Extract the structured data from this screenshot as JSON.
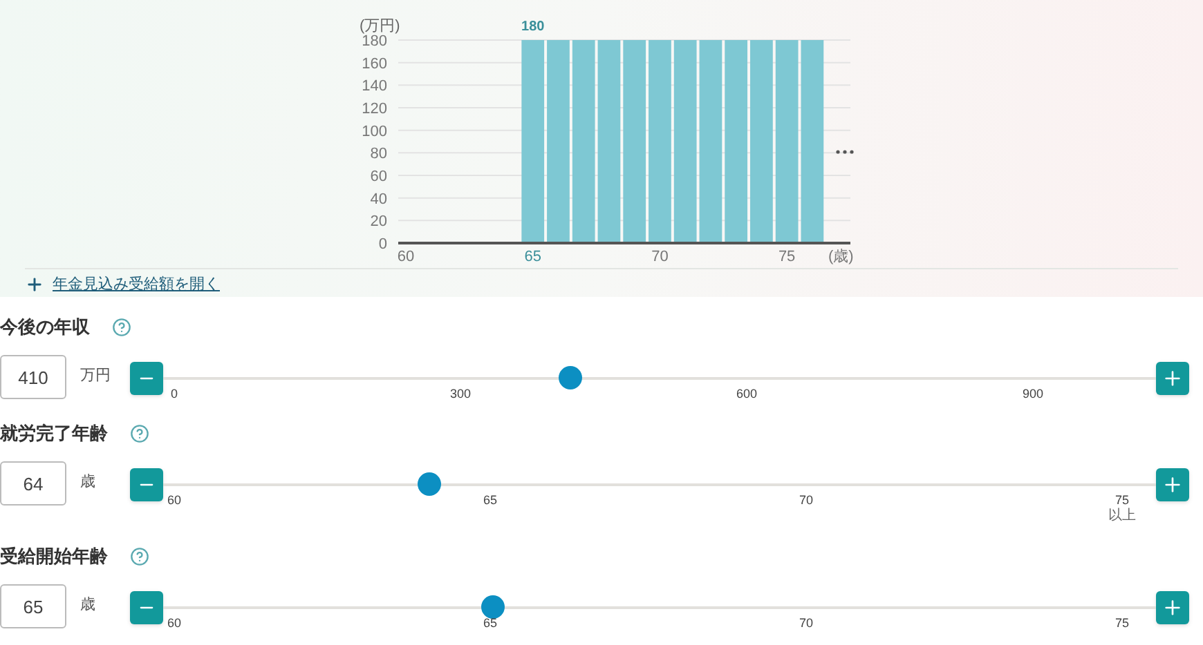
{
  "chart": {
    "chart_data": {
      "type": "bar",
      "ylabel": "(万円)",
      "xlabel": "(歳)",
      "x": [
        65,
        66,
        67,
        68,
        69,
        70,
        71,
        72,
        73,
        74,
        75,
        76
      ],
      "series": [
        {
          "color": "#7ec8d3",
          "values": [
            180,
            180,
            180,
            180,
            180,
            180,
            180,
            180,
            180,
            180,
            180,
            180
          ]
        }
      ],
      "xlim": [
        59.7,
        77.5
      ],
      "ylim": [
        0,
        180
      ],
      "yticks": [
        0,
        20,
        40,
        60,
        80,
        100,
        120,
        140,
        160,
        180
      ],
      "xticks": [
        60,
        65,
        70,
        75
      ],
      "grid": true,
      "annotations": [
        "180"
      ]
    }
  },
  "expand_link": {
    "label": "年金見込み受給額を開く"
  },
  "sliders": [
    {
      "label": "今後の年収",
      "value": "410",
      "unit": "万円",
      "level": 0.41,
      "ticks": [
        {
          "label": "0"
        },
        {
          "label": "300"
        },
        {
          "label": "600"
        },
        {
          "label": "900"
        }
      ]
    },
    {
      "label": "就労完了年齢",
      "value": "64",
      "unit": "歳",
      "level": 0.268,
      "ticks": [
        {
          "label": "60"
        },
        {
          "label": "65"
        },
        {
          "label": "70"
        },
        {
          "label": "75",
          "note": "以上"
        }
      ]
    },
    {
      "label": "受給開始年齢",
      "value": "65",
      "unit": "歳",
      "level": 0.332,
      "ticks": [
        {
          "label": "60"
        },
        {
          "label": "65"
        },
        {
          "label": "70"
        },
        {
          "label": "75"
        }
      ]
    }
  ]
}
